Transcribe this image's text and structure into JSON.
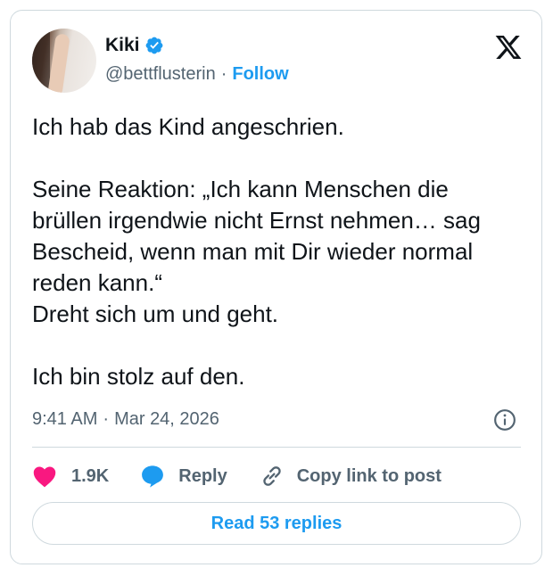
{
  "author": {
    "name": "Kiki",
    "handle": "@bettflusterin",
    "separator": "·",
    "follow_label": "Follow",
    "verified": true
  },
  "tweet": {
    "text": "Ich hab das Kind angeschrien.\n\nSeine Reaktion: „Ich kann Menschen die brüllen irgendwie nicht Ernst nehmen… sag Bescheid, wenn man mit Dir wieder normal reden kann.“\nDreht sich um und geht.\n\nIch bin stolz auf den.",
    "time": "9:41 AM",
    "separator": "·",
    "date": "Mar 24, 2026"
  },
  "actions": {
    "like_count": "1.9K",
    "reply_label": "Reply",
    "copy_label": "Copy link to post"
  },
  "read_replies_label": "Read 53 replies",
  "colors": {
    "accent": "#1d9bf0",
    "like": "#f91880",
    "secondary_text": "#536471",
    "border": "#cfd9de"
  },
  "icons": [
    "verified-badge-icon",
    "x-logo-icon",
    "info-icon",
    "heart-icon",
    "reply-bubble-icon",
    "link-icon"
  ]
}
